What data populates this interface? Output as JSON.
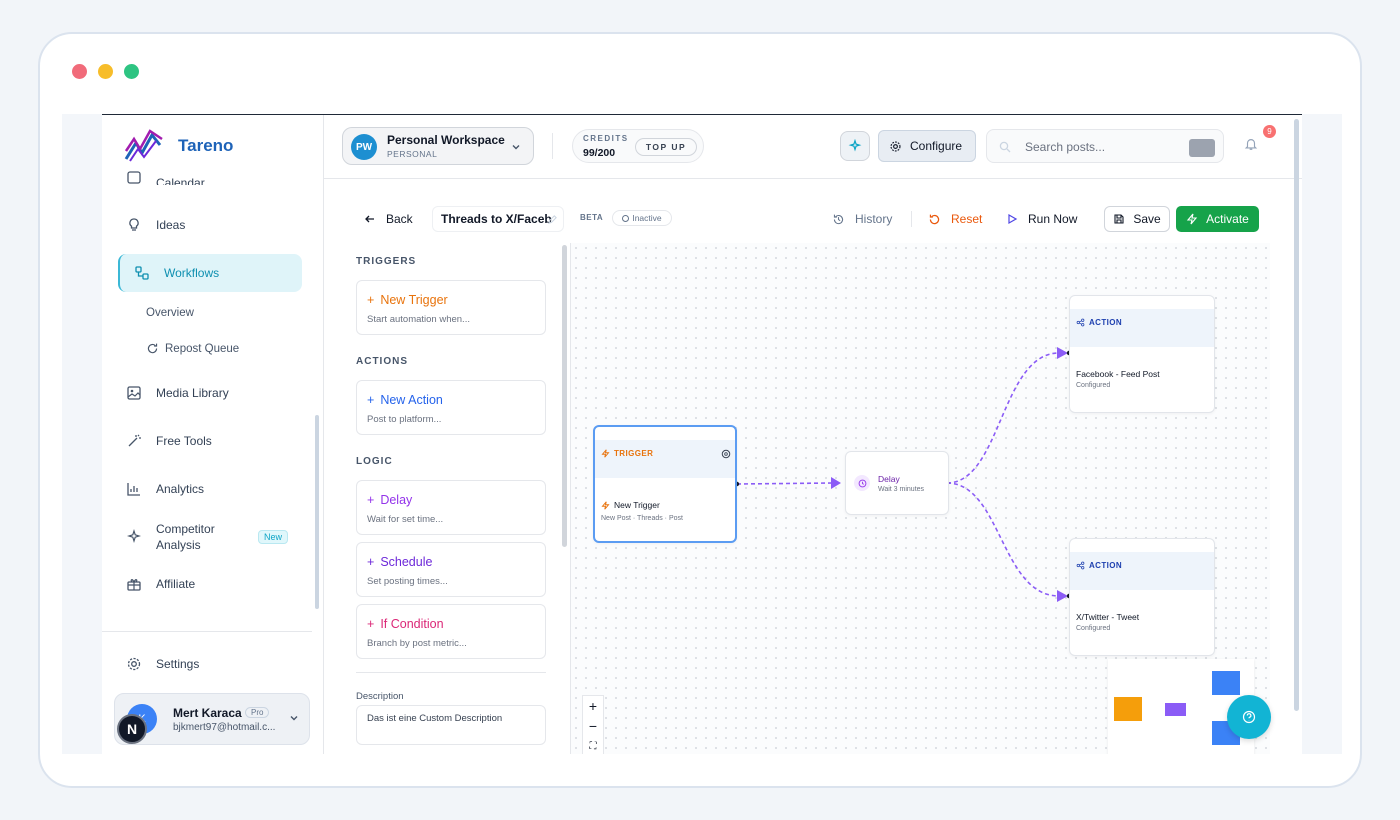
{
  "window": {
    "dots": [
      "#f16b7a",
      "#f7bd2a",
      "#2ec482"
    ]
  },
  "brand": {
    "name": "Tareno",
    "color": "#1e63b8",
    "accent": "#16a34a",
    "link": "#0ea5c6"
  },
  "sidebar": {
    "items": [
      {
        "label": "Calendar",
        "icon": "calendar-icon"
      },
      {
        "label": "Ideas",
        "icon": "lightbulb-icon"
      },
      {
        "label": "Workflows",
        "icon": "workflow-icon",
        "active": true
      },
      {
        "label": "Media Library",
        "icon": "image-icon"
      },
      {
        "label": "Free Tools",
        "icon": "magic-wand-icon"
      },
      {
        "label": "Analytics",
        "icon": "bar-chart-icon"
      },
      {
        "label": "Competitor Analysis",
        "icon": "sparkles-icon",
        "badge": "New"
      },
      {
        "label": "Affiliate",
        "icon": "gift-icon"
      }
    ],
    "sub_items": [
      {
        "label": "Overview"
      },
      {
        "label": "Repost Queue",
        "icon": "refresh-icon"
      }
    ],
    "competitor_line1": "Competitor",
    "competitor_line2": "Analysis",
    "settings": "Settings",
    "user": {
      "name": "Mert Karaca",
      "plan": "Pro",
      "email": "bjkmert97@hotmail.c...",
      "initials": "K",
      "badge": "N"
    }
  },
  "header": {
    "workspace": {
      "initials": "PW",
      "name": "Personal Workspace",
      "type": "PERSONAL"
    },
    "credits": {
      "label": "CREDITS",
      "value": "99/200",
      "topup": "TOP UP"
    },
    "configure": "Configure",
    "search": {
      "placeholder": "Search posts..."
    },
    "notifications": "9"
  },
  "toolbar": {
    "back": "Back",
    "workflow_name": "Threads to X/Faceb",
    "beta": "BETA",
    "status": "Inactive",
    "history": "History",
    "reset": "Reset",
    "run_now": "Run Now",
    "save": "Save",
    "activate": "Activate"
  },
  "palette": {
    "triggers_heading": "TRIGGERS",
    "actions_heading": "ACTIONS",
    "logic_heading": "LOGIC",
    "cards": [
      {
        "title": "New Trigger",
        "sub": "Start automation when...",
        "color": "#e8730c"
      },
      {
        "title": "New Action",
        "sub": "Post to platform...",
        "color": "#2563eb"
      },
      {
        "title": "Delay",
        "sub": "Wait for set time...",
        "color": "#9333ea"
      },
      {
        "title": "Schedule",
        "sub": "Set posting times...",
        "color": "#6d28d9"
      },
      {
        "title": "If Condition",
        "sub": "Branch by post metric...",
        "color": "#db2777"
      }
    ],
    "description_label": "Description",
    "description_value": "Das ist eine Custom Description"
  },
  "canvas": {
    "trigger_node": {
      "tag": "TRIGGER",
      "title": "New Trigger",
      "sub": "New Post · Threads · Post"
    },
    "delay_node": {
      "title": "Delay",
      "sub": "Wait 3 minutes"
    },
    "action_nodes": [
      {
        "tag": "ACTION",
        "title": "Facebook - Feed Post",
        "sub": "Configured"
      },
      {
        "tag": "ACTION",
        "title": "X/Twitter - Tweet",
        "sub": "Configured"
      }
    ],
    "zoom": [
      "+",
      "−",
      "⛶"
    ],
    "edge_color": "#8b5cf6"
  }
}
